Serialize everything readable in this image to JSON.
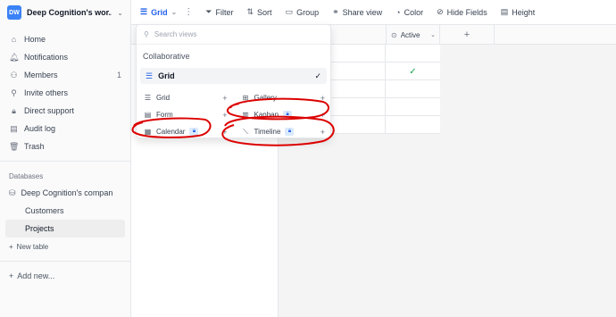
{
  "sidebar": {
    "workspace": {
      "logo": "DW",
      "name": "Deep Cognition's wor..."
    },
    "nav": [
      {
        "icon": "home-icon",
        "glyph": "⌂",
        "label": "Home",
        "count": ""
      },
      {
        "icon": "bell-icon",
        "glyph": "🔔︎",
        "label": "Notifications",
        "count": ""
      },
      {
        "icon": "members-icon",
        "glyph": "⚇",
        "label": "Members",
        "count": "1"
      },
      {
        "icon": "invite-icon",
        "glyph": "⚲",
        "label": "Invite others",
        "count": ""
      },
      {
        "icon": "lock-icon",
        "glyph": "🔒︎",
        "label": "Direct support",
        "count": ""
      },
      {
        "icon": "audit-icon",
        "glyph": "▤",
        "label": "Audit log",
        "count": ""
      },
      {
        "icon": "trash-icon",
        "glyph": "🗑︎",
        "label": "Trash",
        "count": ""
      }
    ],
    "databases_label": "Databases",
    "database": "Deep Cognition's compan",
    "tables": [
      {
        "label": "Customers",
        "active": false
      },
      {
        "label": "Projects",
        "active": true
      }
    ],
    "new_table": "New table",
    "add_new": "Add new..."
  },
  "toolbar": {
    "view": "Grid",
    "filter": "Filter",
    "sort": "Sort",
    "group": "Group",
    "share": "Share view",
    "color": "Color",
    "hide": "Hide Fields",
    "height": "Height"
  },
  "grid": {
    "columns": [
      "Active"
    ],
    "rows": [
      {
        "active": ""
      },
      {
        "active": "✓"
      },
      {
        "active": ""
      },
      {
        "active": ""
      },
      {
        "active": ""
      }
    ],
    "add_column": "+"
  },
  "view_menu": {
    "search_placeholder": "Search views",
    "section": "Collaborative",
    "selected_view": "Grid",
    "create": [
      [
        {
          "icon": "grid-icon",
          "glyph": "☰",
          "label": "Grid",
          "locked": false
        },
        {
          "icon": "gallery-icon",
          "glyph": "⊞",
          "label": "Gallery",
          "locked": false
        }
      ],
      [
        {
          "icon": "form-icon",
          "glyph": "▤",
          "label": "Form",
          "locked": false
        },
        {
          "icon": "kanban-icon",
          "glyph": "▥",
          "label": "Kanban",
          "locked": true
        }
      ],
      [
        {
          "icon": "calendar-icon",
          "glyph": "▦",
          "label": "Calendar",
          "locked": true
        },
        {
          "icon": "timeline-icon",
          "glyph": "⟍",
          "label": "Timeline",
          "locked": true
        }
      ]
    ]
  },
  "colors": {
    "accent": "#2563eb",
    "annotation": "#dc0000"
  }
}
